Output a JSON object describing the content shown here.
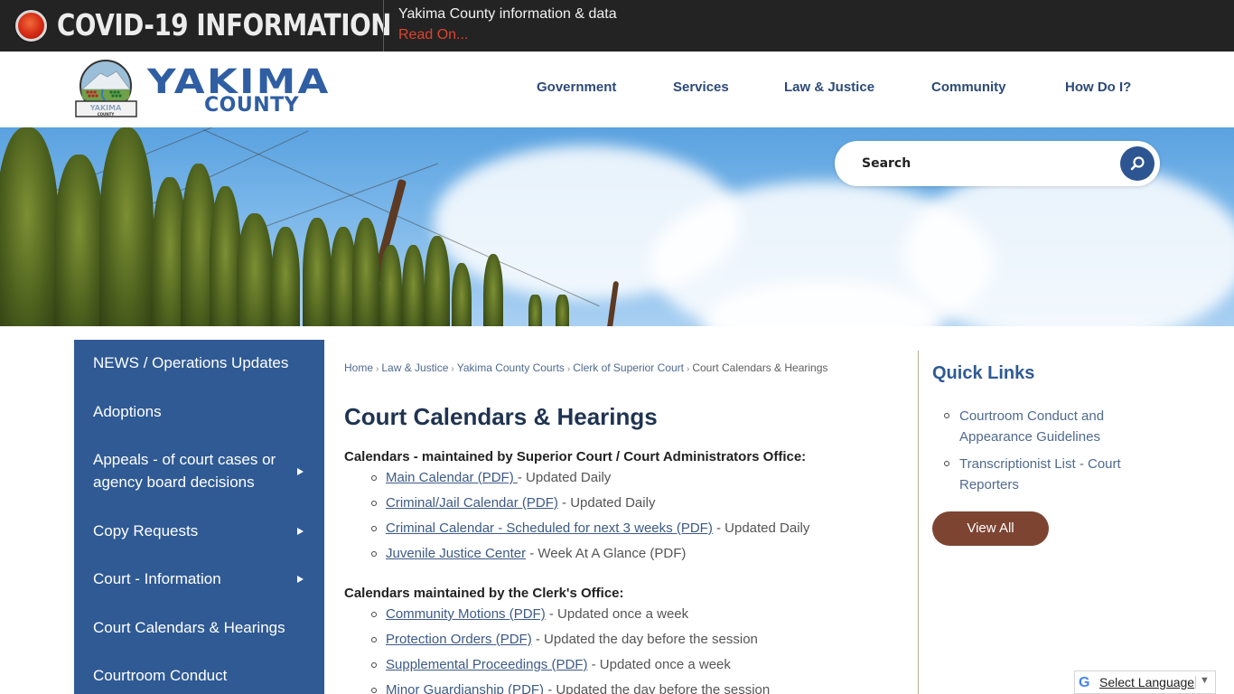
{
  "alert_banner": {
    "title": "COVID-19 INFORMATION",
    "subtitle": "Yakima County information & data",
    "link": "Read On..."
  },
  "header": {
    "logo_word": "YAKIMA",
    "logo_sub": "COUNTY",
    "seal_label": "YAKIMA",
    "seal_sub": "COUNTY",
    "nav": [
      "Government",
      "Services",
      "Law & Justice",
      "Community",
      "How Do I?"
    ]
  },
  "search": {
    "placeholder": "Search"
  },
  "sidebar": {
    "items": [
      {
        "label": "NEWS / Operations Updates",
        "has_submenu": false
      },
      {
        "label": "Adoptions",
        "has_submenu": false
      },
      {
        "label": "Appeals - of court cases or agency board decisions",
        "has_submenu": true
      },
      {
        "label": "Copy Requests",
        "has_submenu": true
      },
      {
        "label": "Court - Information",
        "has_submenu": true
      },
      {
        "label": "Court Calendars & Hearings",
        "has_submenu": false
      },
      {
        "label": "Courtroom Conduct",
        "has_submenu": false
      }
    ]
  },
  "breadcrumb": [
    "Home",
    "Law & Justice",
    "Yakima County Courts",
    "Clerk of Superior Court",
    "Court Calendars & Hearings"
  ],
  "page": {
    "title": "Court Calendars & Hearings",
    "sections": [
      {
        "heading": "Calendars - maintained by Superior Court / Court Administrators Office:",
        "items": [
          {
            "link": "Main Calendar (PDF) ",
            "note": " - Updated Daily"
          },
          {
            "link": "Criminal/Jail Calendar (PDF)",
            "note": " - Updated Daily"
          },
          {
            "link": "Criminal Calendar - Scheduled for next 3 weeks (PDF)",
            "note": " - Updated Daily"
          },
          {
            "link": "Juvenile Justice Center",
            "note": " - Week At A Glance (PDF)"
          }
        ]
      },
      {
        "heading": "Calendars maintained by the Clerk's Office:",
        "items": [
          {
            "link": "Community Motions (PDF)",
            "note": " - Updated once a week"
          },
          {
            "link": "Protection Orders (PDF)",
            "note": " - Updated the day before the session"
          },
          {
            "link": "Supplemental Proceedings (PDF)",
            "note": " - Updated once a week"
          },
          {
            "link": "Minor Guardianship (PDF)",
            "note": " - Updated the day  before the session"
          }
        ]
      }
    ]
  },
  "quick_links": {
    "title": "Quick Links",
    "items": [
      "Courtroom Conduct and Appearance Guidelines",
      "Transcriptionist List - Court Reporters"
    ],
    "view_all": "View All"
  },
  "translate": {
    "label": "Select Language",
    "caret": "▼",
    "logo": "G"
  },
  "colors": {
    "banner_bg": "#232323",
    "alert_red": "#e0432e",
    "brand_blue": "#2f5a94",
    "title_navy": "#1f3351",
    "view_all_brown": "#7d4432"
  }
}
